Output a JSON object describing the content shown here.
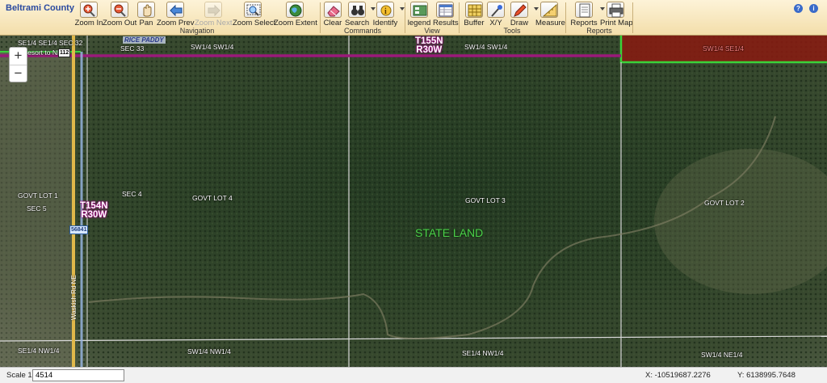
{
  "app_title": "Beltrami County",
  "toolbar": {
    "navigation": {
      "title": "Navigation",
      "tools": [
        {
          "label": "Zoom In",
          "icon": "zoom-in-icon"
        },
        {
          "label": "Zoom Out",
          "icon": "zoom-out-icon"
        },
        {
          "label": "Pan",
          "icon": "pan-hand-icon"
        },
        {
          "label": "Zoom Prev",
          "icon": "arrow-left-icon"
        },
        {
          "label": "Zoom Next",
          "icon": "arrow-right-icon"
        },
        {
          "label": "Zoom Select",
          "icon": "zoom-select-icon"
        },
        {
          "label": "Zoom Extent",
          "icon": "globe-icon"
        }
      ]
    },
    "commands": {
      "title": "Commands",
      "tools": [
        {
          "label": "Clear",
          "icon": "eraser-icon"
        },
        {
          "label": "Search",
          "icon": "binoculars-icon"
        },
        {
          "label": "Identify",
          "icon": "identify-icon"
        }
      ]
    },
    "view": {
      "title": "View",
      "tools": [
        {
          "label": "legend",
          "icon": "legend-icon"
        },
        {
          "label": "Results",
          "icon": "results-table-icon"
        }
      ]
    },
    "tools": {
      "title": "Tools",
      "tools": [
        {
          "label": "Buffer",
          "icon": "buffer-grid-icon"
        },
        {
          "label": "X/Y",
          "icon": "xy-pin-icon"
        },
        {
          "label": "Draw",
          "icon": "pencil-icon"
        },
        {
          "label": "Measure",
          "icon": "ruler-icon"
        }
      ]
    },
    "reports": {
      "title": "Reports",
      "tools": [
        {
          "label": "Reports",
          "icon": "reports-icon"
        },
        {
          "label": "Print Map",
          "icon": "printer-icon"
        }
      ]
    }
  },
  "map": {
    "labels": {
      "top_left_1": "SE1/4 SE1/4 SEC 32",
      "resort": "Resort to NE",
      "sec33": "SEC 33",
      "rice_paddy": "RICE PADDY",
      "sw_nw_top": "SW1/4 SW1/4",
      "sw_sw_top": "SW1/4 SW1/4",
      "sw_se_top": "SW1/4 SE1/4",
      "govt_lot_1": "GOVT LOT 1",
      "sec5": "SEC 5",
      "sec4": "SEC 4",
      "govt_lot_4": "GOVT LOT 4",
      "govt_lot_3": "GOVT LOT 3",
      "govt_lot_2": "GOVT LOT 2",
      "state_land": "STATE LAND",
      "se_nw_bottom": "SE1/4 NW1/4",
      "sw_nw_bottom": "SW1/4 NW1/4",
      "se_nw_bottom2": "SE1/4 NW1/4",
      "sw_ne_bottom": "SW1/4 NE1/4",
      "road_name": "Waskish Rd NE",
      "shield_112": "112",
      "shield_56841": "56841"
    },
    "township_top": {
      "t": "T155N",
      "r": "R30W"
    },
    "township_left": {
      "t": "T154N",
      "r": "R30W"
    },
    "colors": {
      "state_land": "#4cd04a",
      "township_line": "#9a1a7a",
      "highlight_fill": "#8a1a10",
      "highlight_border": "#3ad23a"
    }
  },
  "zoom": {
    "plus": "+",
    "minus": "−"
  },
  "status": {
    "scale_label": "Scale 1:",
    "scale_value": "4514",
    "x": "X: -10519687.2276",
    "y": "Y: 6138995.7648"
  }
}
